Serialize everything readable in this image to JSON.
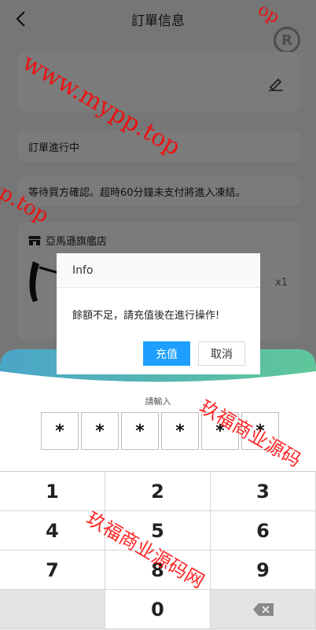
{
  "header": {
    "title": "訂單信息"
  },
  "order": {
    "status": "訂單進行中",
    "notice": "等待買方確認。超時60分鐘未支付將進入凍結。",
    "shop_name": "亞馬遜旗艦店",
    "quantity": "x1"
  },
  "dialog": {
    "title": "Info",
    "message": "餘額不足，請充值後在進行操作!",
    "confirm_label": "充值",
    "cancel_label": "取消"
  },
  "keypad": {
    "prompt": "請輸入",
    "password_chars": [
      "*",
      "*",
      "*",
      "*",
      "*",
      "*"
    ],
    "keys": [
      "1",
      "2",
      "3",
      "4",
      "5",
      "6",
      "7",
      "8",
      "9",
      "0"
    ]
  },
  "watermarks": [
    "www.mypp.top",
    "pp.top",
    "玖福商业源码",
    "玖福商业源码网",
    "op"
  ],
  "colors": {
    "primary": "#1e9fff",
    "gradient_start": "#4aa5c8",
    "gradient_end": "#5fc79a"
  }
}
